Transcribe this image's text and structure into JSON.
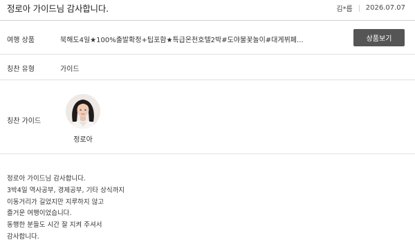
{
  "header": {
    "title": "정로아 가이드님 감사합니다.",
    "author": "김*름",
    "date": "2026.07.07"
  },
  "product": {
    "label": "여행 상품",
    "value": "북해도4일★100%출발확정+팁포함★특급온천호텔2박#도야불꽃놀이#대게뷔페...",
    "button_label": "상품보기"
  },
  "praise_type": {
    "label": "칭찬 유형",
    "value": "가이드"
  },
  "praise_guide": {
    "label": "칭찬 가이드",
    "name": "정로아"
  },
  "review": {
    "lines": [
      "정로아 가이드님 감사합니다.",
      "3박4일 역사공부, 경제공부, 기타 상식까지",
      "이동거리가 길었지만 지루하지 않고",
      "즐거운 여행이었습니다.",
      "동행한 분들도 시간 잘 지켜 주셔서",
      "감사합니다."
    ]
  },
  "colors": {
    "button_bg": "#555555",
    "divider": "#e1e1e1"
  }
}
